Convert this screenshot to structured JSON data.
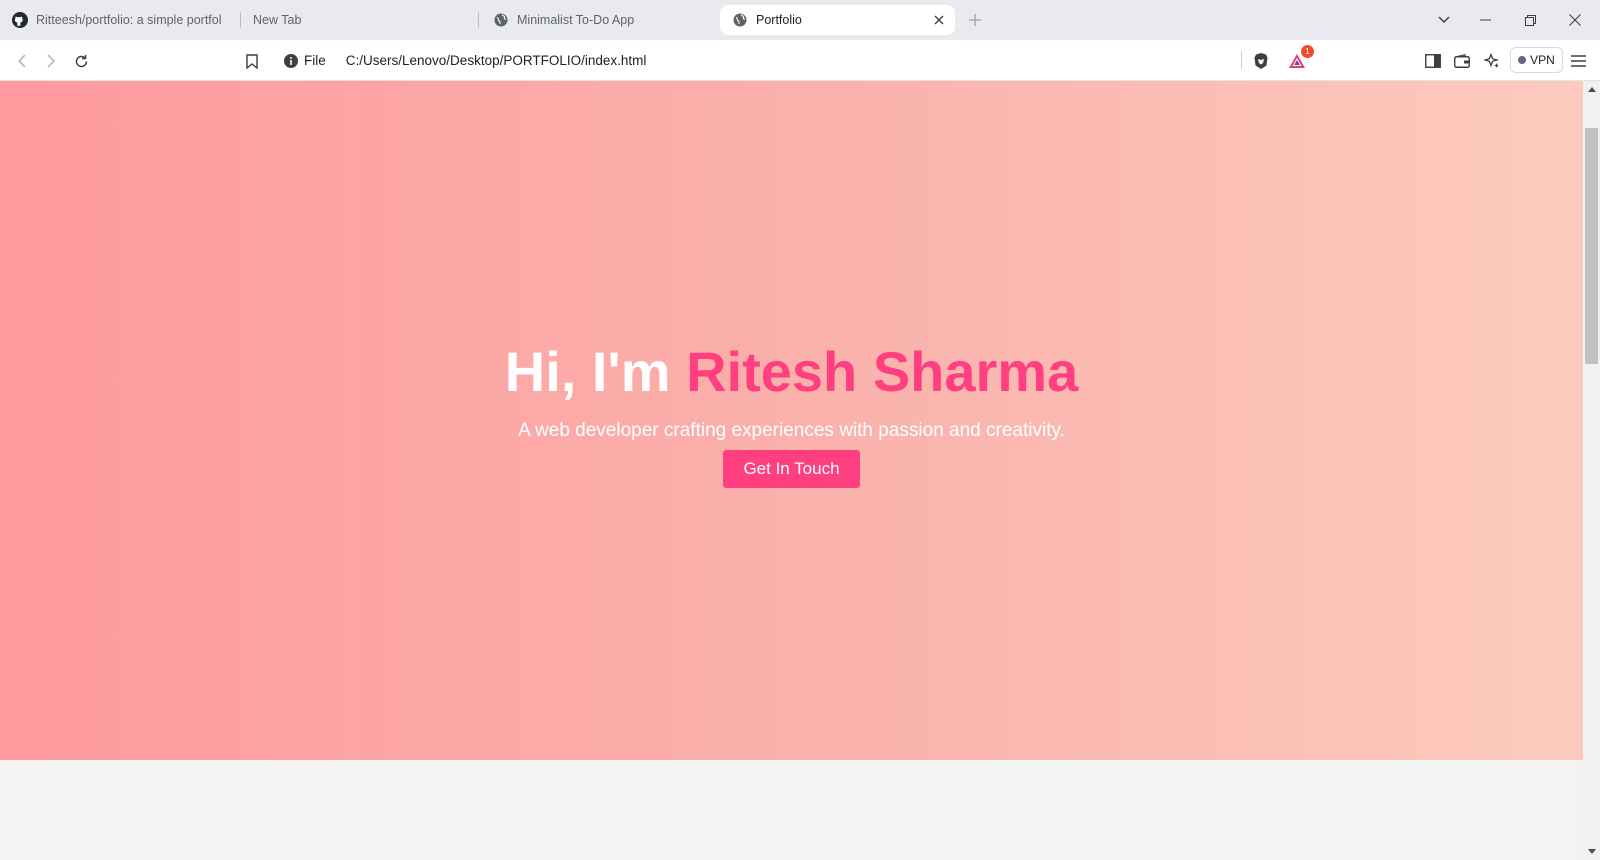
{
  "browser": {
    "tabs": [
      {
        "title": "Ritteesh/portfolio: a simple portfolio",
        "icon": "github-icon",
        "active": false
      },
      {
        "title": "New Tab",
        "icon": "",
        "active": false
      },
      {
        "title": "Minimalist To-Do App",
        "icon": "globe-icon",
        "active": false
      },
      {
        "title": "Portfolio",
        "icon": "globe-icon",
        "active": true
      }
    ],
    "address": {
      "scheme_label": "File",
      "url": "C:/Users/Lenovo/Desktop/PORTFOLIO/index.html"
    },
    "notification_count": "1",
    "vpn_label": "VPN"
  },
  "hero": {
    "greeting": "Hi, I'm",
    "name": "Ritesh Sharma",
    "tagline": "A web developer crafting experiences with passion and creativity.",
    "cta_label": "Get In Touch"
  },
  "colors": {
    "accent": "#ff3f80",
    "hero_gradient_start": "#ff9a9e",
    "hero_gradient_end": "#fccbbd"
  }
}
